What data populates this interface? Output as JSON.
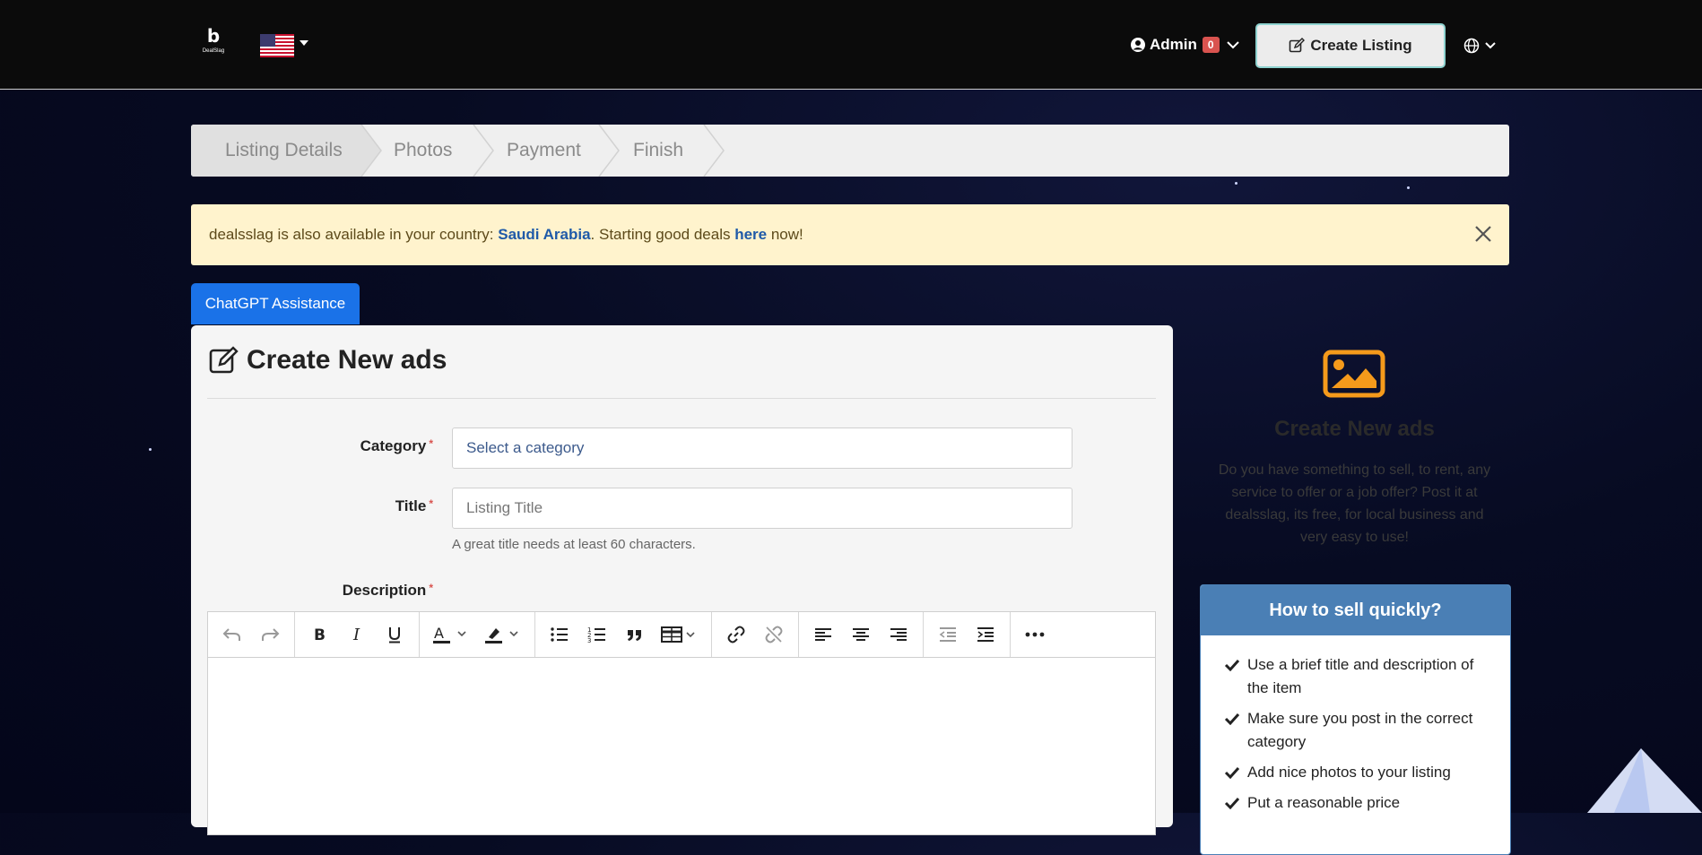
{
  "header": {
    "logo_text": "DealSlag",
    "user_name": "Admin",
    "notification_count": "0",
    "create_listing_label": "Create Listing"
  },
  "steps": [
    "Listing Details",
    "Photos",
    "Payment",
    "Finish"
  ],
  "alert": {
    "prefix": "dealsslag is also available in your country: ",
    "country": "Saudi Arabia",
    "middle": ". Starting good deals ",
    "link": "here",
    "suffix": " now!"
  },
  "chatgpt_label": "ChatGPT Assistance",
  "form": {
    "title": "Create New ads",
    "category_label": "Category",
    "category_value": "Select a category",
    "title_label": "Title",
    "title_placeholder": "Listing Title",
    "title_hint": "A great title needs at least 60 characters.",
    "description_label": "Description"
  },
  "sidebar": {
    "title": "Create New ads",
    "text": "Do you have something to sell, to rent, any service to offer or a job offer? Post it at dealsslag, its free, for local business and very easy to use!"
  },
  "tips": {
    "heading": "How to sell quickly?",
    "items": [
      "Use a brief title and description of the item",
      "Make sure you post in the correct category",
      "Add nice photos to your listing",
      "Put a reasonable price"
    ]
  },
  "colors": {
    "accent_blue": "#1a72e8",
    "tips_blue": "#4a7fb5",
    "alert_bg": "#fff3cd",
    "image_icon_orange": "#f59a1b",
    "badge_red": "#d9534f"
  }
}
